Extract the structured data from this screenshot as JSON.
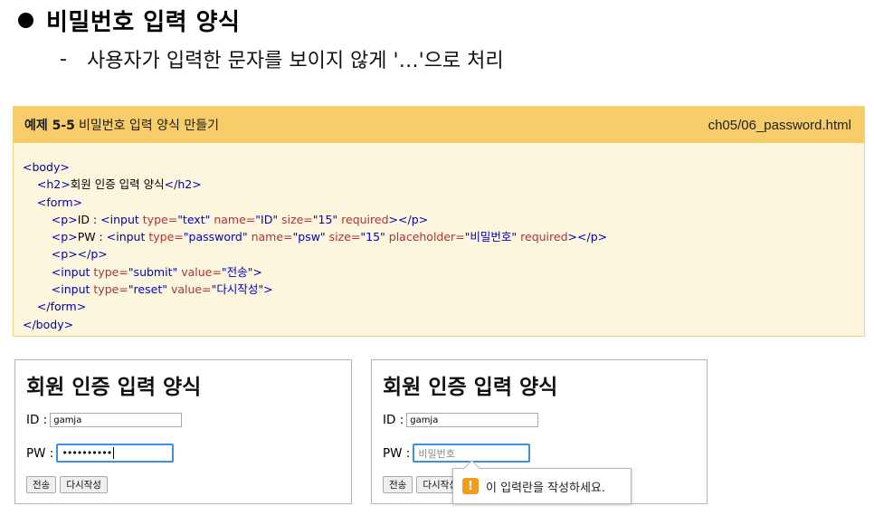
{
  "slide": {
    "heading": "비밀번호 입력 양식",
    "subtext_dash": "-",
    "subtext": "사용자가 입력한 문자를 보이지 않게 '…'으로 처리"
  },
  "example": {
    "label_num": "예제 5-5",
    "label_title": "비밀번호 입력 양식 만들기",
    "file": "ch05/06_password.html",
    "code": {
      "body_open": "<body>",
      "h2_open": "<h2>",
      "h2_text": "회원 인증 입력 양식",
      "h2_close": "</h2>",
      "form_open": "<form>",
      "p_open": "<p>",
      "id_text": "ID : ",
      "input_open": "<input ",
      "type_attr": "type=",
      "type_text": "\"text\"",
      "name_attr": " name=",
      "name_id": "\"ID\"",
      "size_attr": " size=",
      "size_val": "\"15\"",
      "required": " required",
      "p_close": "></p>",
      "pw_text": "PW : ",
      "type_password": "\"password\"",
      "name_psw": "\"psw\"",
      "placeholder_attr": " placeholder=",
      "placeholder_val": "\"비밀번호\"",
      "p_empty": "<p></p>",
      "type_submit": "\"submit\"",
      "value_attr": " value=",
      "submit_val": "\"전송\"",
      "type_reset": "\"reset\"",
      "reset_val": "\"다시작성\"",
      "gt": ">",
      "form_close": "</form>",
      "body_close": "</body>"
    }
  },
  "left_pane": {
    "title": "회원 인증 입력 양식",
    "id_label": "ID :",
    "id_value": "gamja",
    "pw_label": "PW :",
    "pw_value": "••••••••••",
    "submit_label": "전송",
    "reset_label": "다시작성"
  },
  "right_pane": {
    "title": "회원 인증 입력 양식",
    "id_label": "ID :",
    "id_value": "gamja",
    "pw_label": "PW :",
    "pw_placeholder": "비밀번호",
    "submit_label": "전송",
    "reset_label": "다시작성"
  },
  "tooltip": {
    "icon": "!",
    "message": "이 입력란을 작성하세요."
  },
  "colors": {
    "example_header": "#f7cd69",
    "example_body": "#fdf6df",
    "focus_border": "#3d8fe0",
    "warning": "#f39b1c"
  }
}
